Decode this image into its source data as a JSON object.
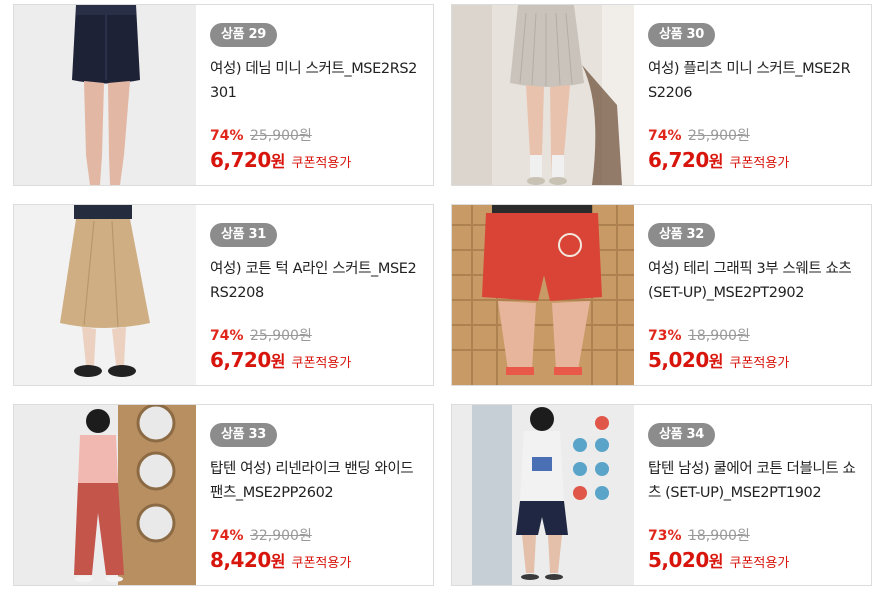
{
  "products": [
    {
      "badge": "상품 29",
      "title": "여성) 데님 미니 스커트_MSE2RS2301",
      "discount": "74%",
      "original_price": "25,900원",
      "sale_price": "6,720",
      "currency": "원",
      "coupon": "쿠폰적용가",
      "image": "denim-mini-skirt-photo"
    },
    {
      "badge": "상품 30",
      "title": "여성) 플리츠 미니 스커트_MSE2RS2206",
      "discount": "74%",
      "original_price": "25,900원",
      "sale_price": "6,720",
      "currency": "원",
      "coupon": "쿠폰적용가",
      "image": "pleated-mini-skirt-photo"
    },
    {
      "badge": "상품 31",
      "title": "여성) 코튼 턱 A라인 스커트_MSE2RS2208",
      "discount": "74%",
      "original_price": "25,900원",
      "sale_price": "6,720",
      "currency": "원",
      "coupon": "쿠폰적용가",
      "image": "cotton-a-line-skirt-photo"
    },
    {
      "badge": "상품 32",
      "title": "여성) 테리 그래픽 3부 스웨트 쇼츠 (SET-UP)_MSE2PT2902",
      "discount": "73%",
      "original_price": "18,900원",
      "sale_price": "5,020",
      "currency": "원",
      "coupon": "쿠폰적용가",
      "image": "terry-sweat-shorts-photo"
    },
    {
      "badge": "상품 33",
      "title": "탑텐 여성) 리넨라이크 밴딩 와이드 팬츠_MSE2PP2602",
      "discount": "74%",
      "original_price": "32,900원",
      "sale_price": "8,420",
      "currency": "원",
      "coupon": "쿠폰적용가",
      "image": "linen-wide-pants-photo"
    },
    {
      "badge": "상품 34",
      "title": "탑텐 남성) 쿨에어 코튼 더블니트 쇼츠 (SET-UP)_MSE2PT1902",
      "discount": "73%",
      "original_price": "18,900원",
      "sale_price": "5,020",
      "currency": "원",
      "coupon": "쿠폰적용가",
      "image": "cool-air-shorts-photo"
    }
  ],
  "colors": {
    "badge_bg": "#8c8c8c",
    "price_red": "#d8150c",
    "discount_red": "#e0261b",
    "strike_gray": "#9a9a9a",
    "border": "#dcdcdc"
  }
}
